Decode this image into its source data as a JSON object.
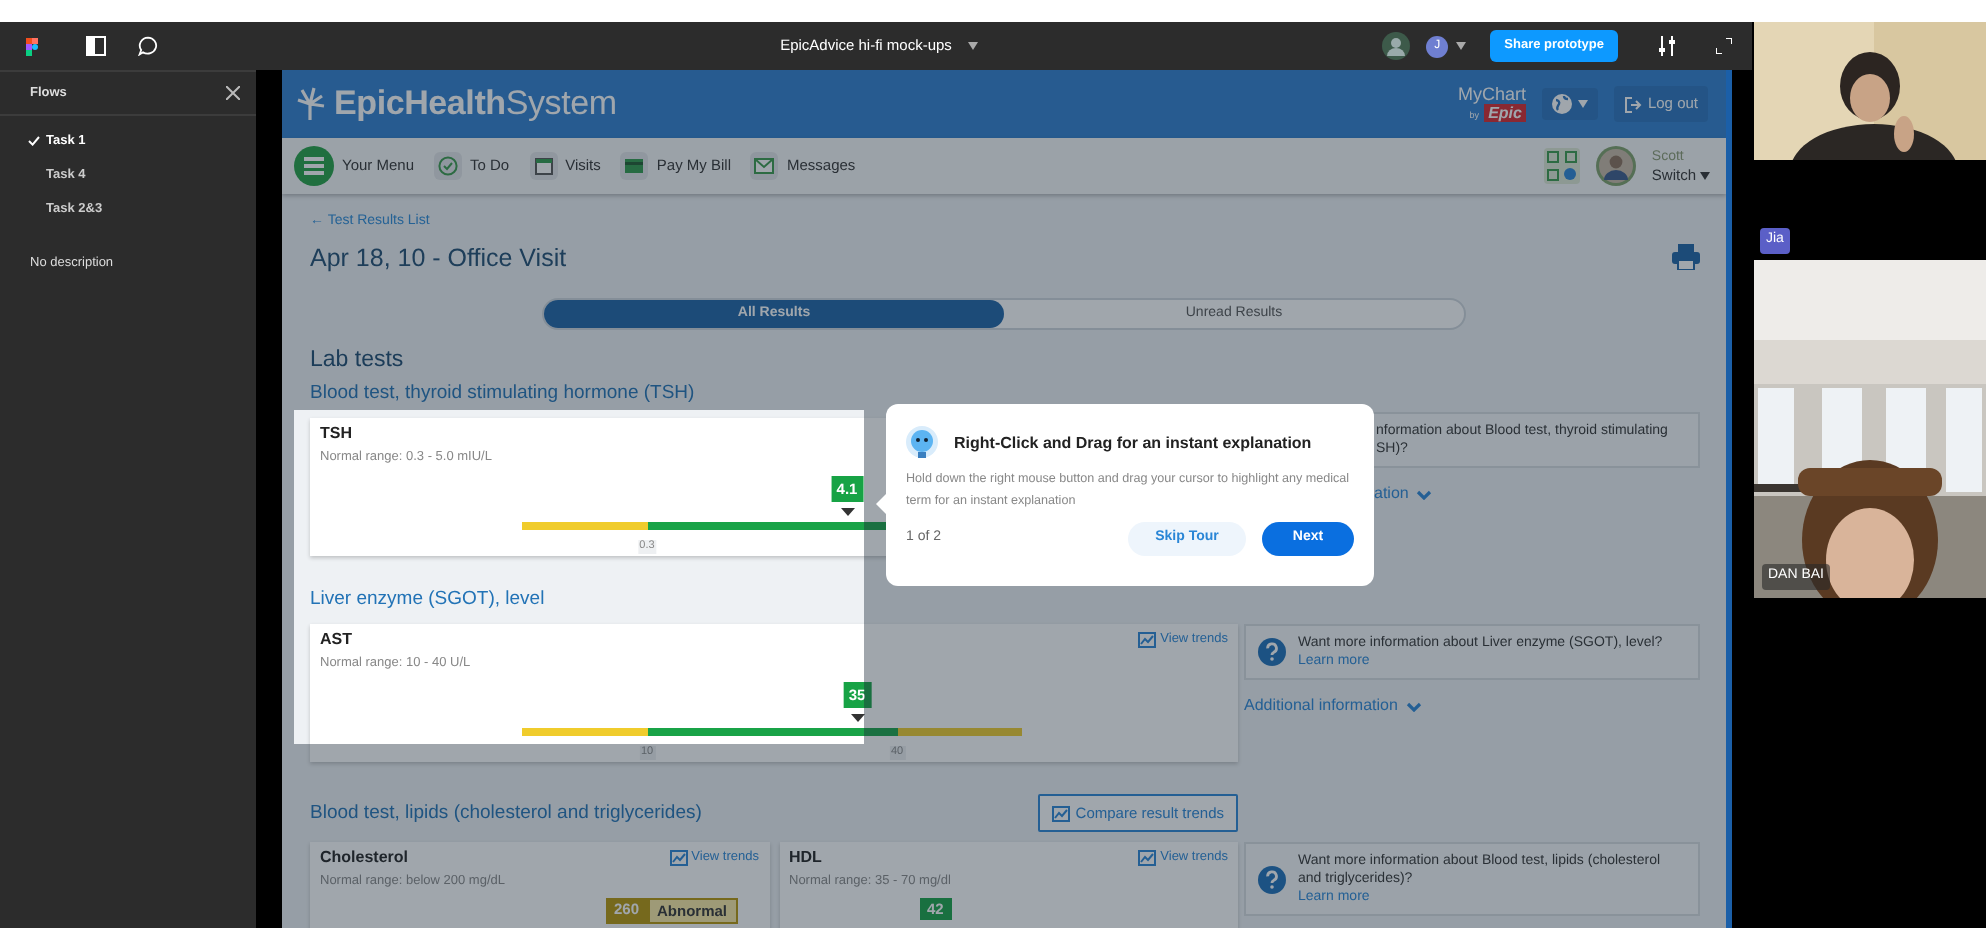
{
  "app_bar": {
    "title": "EpicAdvice hi-fi mock-ups",
    "avatar_initial": "J",
    "share_button": "Share prototype"
  },
  "flows_panel": {
    "title": "Flows",
    "flows": [
      {
        "label": "Task 1",
        "selected": true
      },
      {
        "label": "Task 4",
        "selected": false
      },
      {
        "label": "Task 2&3",
        "selected": false
      }
    ],
    "description": "No description"
  },
  "prototype": {
    "header": {
      "logo": "**EpicHealth**System",
      "mychart": "MyChart",
      "mychart_by": "by",
      "mychart_epic": "Epic",
      "logout": "Log out"
    },
    "nav": [
      {
        "label": "Your Menu",
        "kind": "menu"
      },
      {
        "label": "To Do",
        "kind": "todo"
      },
      {
        "label": "Visits",
        "kind": "visits"
      },
      {
        "label": "Pay My Bill",
        "kind": "bill"
      },
      {
        "label": "Messages",
        "kind": "messages"
      }
    ],
    "user": {
      "name": "Scott",
      "switch": "Switch"
    },
    "back_link": "← Test Results List",
    "title": "Apr 18, 10 - Office Visit",
    "tabs": [
      {
        "label": "All Results",
        "selected": true
      },
      {
        "label": "Unread Results",
        "selected": false
      }
    ],
    "section": "Lab tests",
    "groups": [
      {
        "title": "Blood test, thyroid stimulating hormone (TSH)",
        "results": [
          {
            "name": "TSH",
            "range": "Normal range: 0.3 - 5.0 mIU/L",
            "value": "4.1",
            "abnormal": false,
            "level": 0.65,
            "ticks": [
              "0.3"
            ]
          }
        ],
        "info": {
          "lines": [
            "nformation about Blood test, thyroid stimulating",
            "SH)?"
          ],
          "covered": true
        },
        "additional": "ation"
      },
      {
        "title": "Liver enzyme (SGOT), level",
        "results": [
          {
            "name": "AST",
            "range": "Normal range: 10 - 40 U/L",
            "value": "35",
            "abnormal": false,
            "level": 0.67,
            "ticks": [
              "10",
              "40"
            ],
            "view_trends": "View trends"
          }
        ],
        "info": {
          "lines": [
            "Want more information about Liver enzyme (SGOT), level?"
          ],
          "link": "Learn more",
          "covered": false
        },
        "additional": "Additional information"
      },
      {
        "title": "Blood test, lipids (cholesterol and triglycerides)",
        "compare_button": "Compare result trends",
        "results": [
          {
            "name": "Cholesterol",
            "range": "Normal range: below 200 mg/dL",
            "value": "260",
            "abnormal": true,
            "flag": "Abnormal",
            "view_trends": "View trends"
          },
          {
            "name": "HDL",
            "range": "Normal range: 35 - 70 mg/dl",
            "value": "42",
            "abnormal": false,
            "view_trends": "View trends"
          }
        ],
        "info": {
          "lines": [
            "Want more information about Blood test, lipids (cholesterol",
            "and triglycerides)?"
          ],
          "link": "Learn more",
          "covered": false
        }
      }
    ],
    "tour": {
      "title": "Right-Click and Drag for an instant explanation",
      "body": "Hold down the right mouse button and drag your cursor to highlight any medical term for an instant explanation",
      "step": "1 of 2",
      "skip": "Skip Tour",
      "next": "Next"
    }
  },
  "video_tiles": [
    {
      "kind": "picture"
    },
    {
      "kind": "picture",
      "tag": "Jia",
      "name": "DAN BAI"
    }
  ]
}
